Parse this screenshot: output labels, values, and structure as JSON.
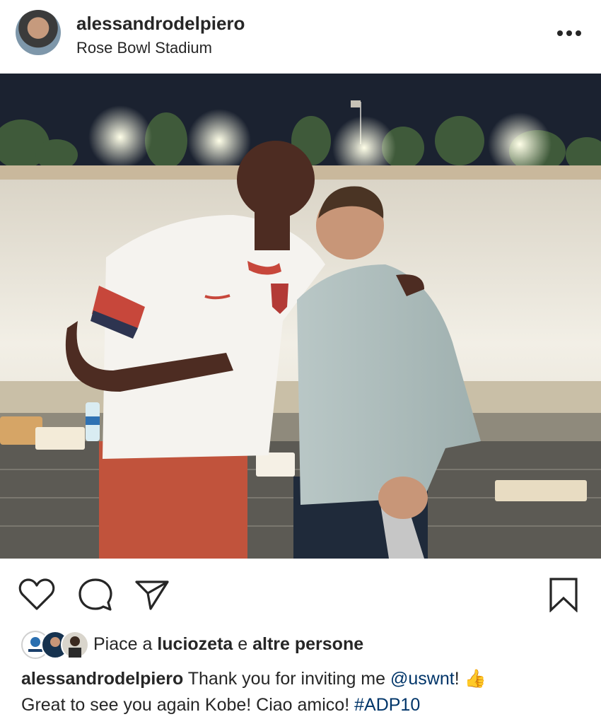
{
  "post": {
    "username": "alessandrodelpiero",
    "location": "Rose Bowl Stadium"
  },
  "icons": {
    "more": "more-options-icon",
    "like": "heart-icon",
    "comment": "comment-icon",
    "share": "paper-plane-icon",
    "save": "bookmark-icon",
    "emoji": "thumbs-up-emoji"
  },
  "likes": {
    "prefix": "Piace a ",
    "user": "luciozeta",
    "connector": " e ",
    "others": "altre persone"
  },
  "caption": {
    "username": "alessandrodelpiero",
    "text1": " Thank you for inviting me ",
    "mention": "@uswnt",
    "text2": "! ",
    "emoji": "👍",
    "line2": "Great to see you again Kobe! Ciao amico! ",
    "hashtag": "#ADP10"
  },
  "colors": {
    "text": "#262626",
    "link": "#003569",
    "night_sky": "#1b2230"
  }
}
